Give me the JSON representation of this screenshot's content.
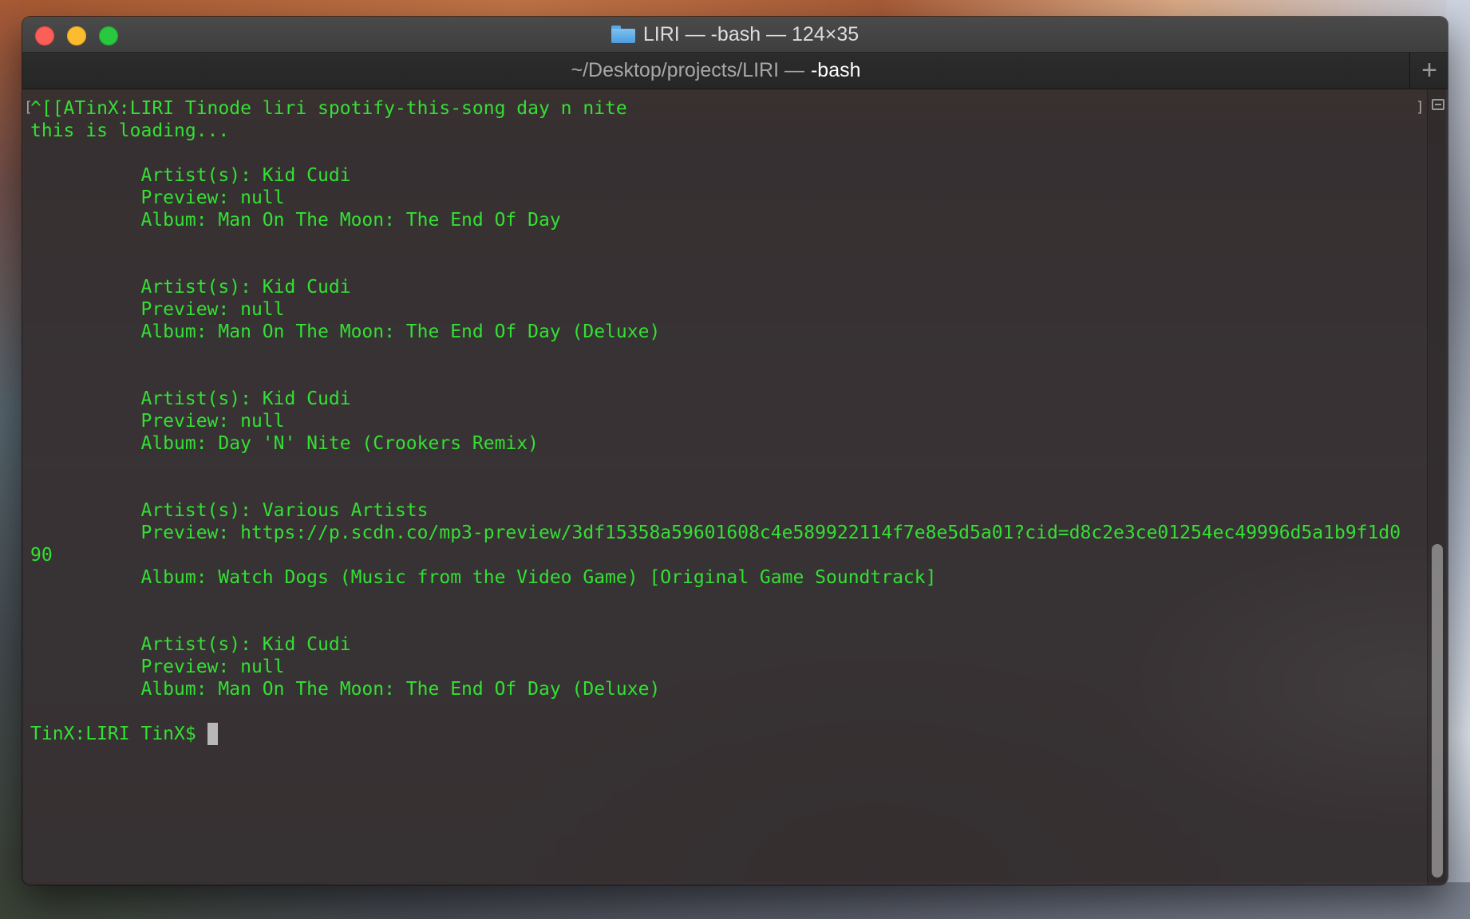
{
  "window": {
    "title": "LIRI — -bash — 124×35",
    "tab_path": "~/Desktop/projects/LIRI —",
    "tab_process": "-bash",
    "new_tab_symbol": "+"
  },
  "terminal": {
    "marker_left": "[",
    "marker_right": "]",
    "lines": [
      "^[[ATinX:LIRI Tinode liri spotify-this-song day n nite",
      "this is loading...",
      "",
      "          Artist(s): Kid Cudi",
      "          Preview: null",
      "          Album: Man On The Moon: The End Of Day",
      "",
      "",
      "          Artist(s): Kid Cudi",
      "          Preview: null",
      "          Album: Man On The Moon: The End Of Day (Deluxe)",
      "",
      "",
      "          Artist(s): Kid Cudi",
      "          Preview: null",
      "          Album: Day 'N' Nite (Crookers Remix)",
      "",
      "",
      "          Artist(s): Various Artists",
      "          Preview: https://p.scdn.co/mp3-preview/3df15358a59601608c4e589922114f7e8e5d5a01?cid=d8c2e3ce01254ec49996d5a1b9f1d0",
      "90",
      "          Album: Watch Dogs (Music from the Video Game) [Original Game Soundtrack]",
      "",
      "",
      "          Artist(s): Kid Cudi",
      "          Preview: null",
      "          Album: Man On The Moon: The End Of Day (Deluxe)",
      ""
    ],
    "prompt": "TinX:LIRI TinX$ "
  },
  "colors": {
    "terminal_text": "#33e033",
    "close": "#fc5f57",
    "minimize": "#fdbc2e",
    "maximize": "#28c840"
  },
  "icons": {
    "title_folder": "folder-icon",
    "new_tab": "plus-icon"
  },
  "scrollbar": {
    "position_fraction": 0.57
  }
}
